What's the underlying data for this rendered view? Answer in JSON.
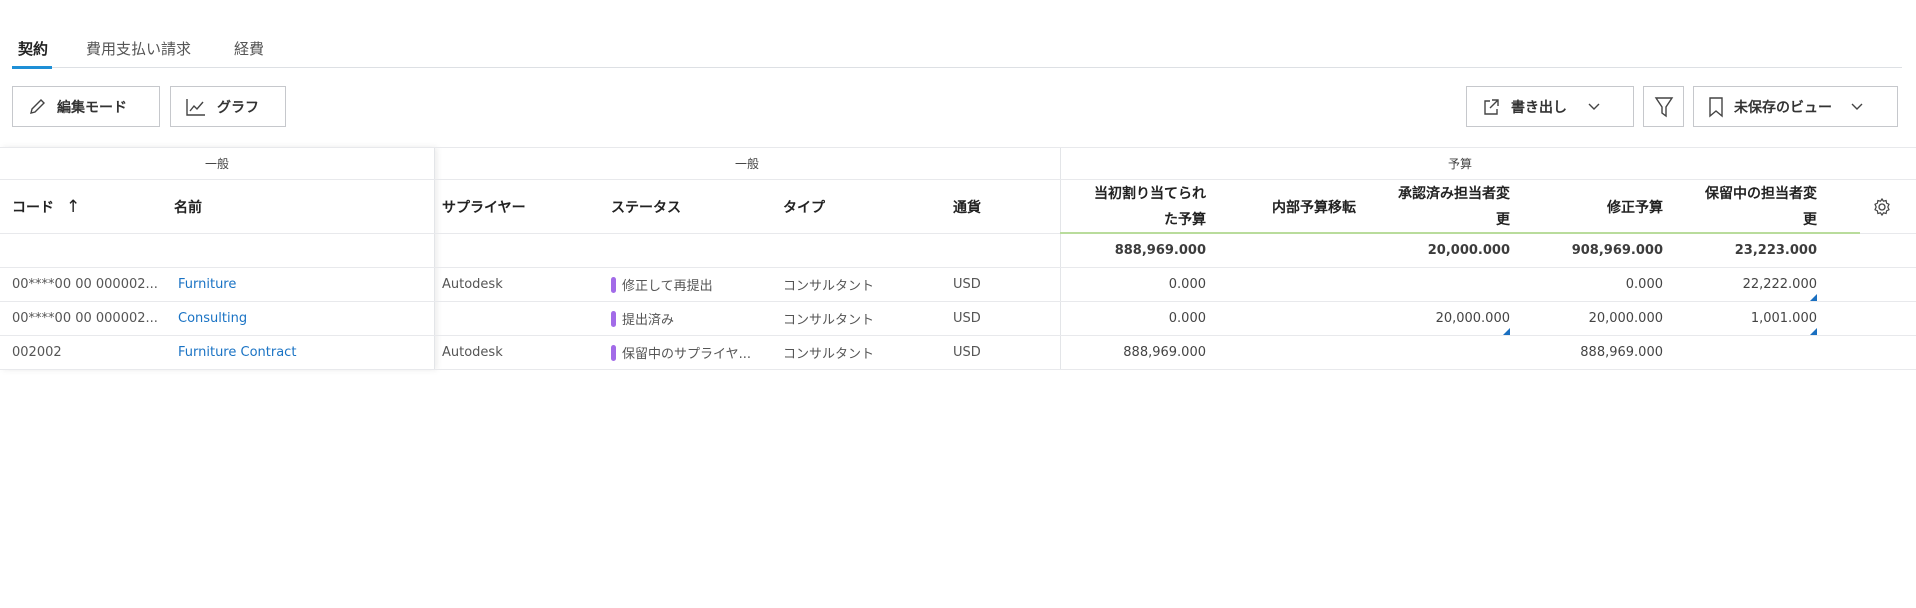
{
  "tabs": [
    {
      "label": "契約",
      "active": true
    },
    {
      "label": "費用支払い請求"
    },
    {
      "label": "経費"
    }
  ],
  "toolbar": {
    "edit_mode": "編集モード",
    "graph": "グラフ",
    "export": "書き出し",
    "view": "未保存のビュー"
  },
  "groups": {
    "left": "一般",
    "middle": "一般",
    "budget": "予算"
  },
  "columns": {
    "code": "コード",
    "name": "名前",
    "supplier": "サプライヤー",
    "status": "ステータス",
    "type": "タイプ",
    "currency": "通貨",
    "original_budget_1": "当初割り当てられ",
    "original_budget_2": "た予算",
    "internal_transfer": "内部予算移転",
    "approved_changes_1": "承認済み担当者変",
    "approved_changes_2": "更",
    "revised_budget": "修正予算",
    "pending_changes_1": "保留中の担当者変",
    "pending_changes_2": "更"
  },
  "sort": {
    "column": "code",
    "direction": "asc"
  },
  "totals": {
    "original_budget": "888,969.000",
    "internal_transfer": "",
    "approved_changes": "20,000.000",
    "revised_budget": "908,969.000",
    "pending_changes": "23,223.000"
  },
  "rows": [
    {
      "code": "00****00 00 000002...",
      "name": "Furniture",
      "supplier": "Autodesk",
      "status": "修正して再提出",
      "type": "コンサルタント",
      "currency": "USD",
      "original_budget": "0.000",
      "internal_transfer": "",
      "approved_changes": "",
      "revised_budget": "0.000",
      "pending_changes": "22,222.000"
    },
    {
      "code": "00****00 00 000002...",
      "name": "Consulting",
      "supplier": "",
      "status": "提出済み",
      "type": "コンサルタント",
      "currency": "USD",
      "original_budget": "0.000",
      "internal_transfer": "",
      "approved_changes": "20,000.000",
      "revised_budget": "20,000.000",
      "pending_changes": "1,001.000"
    },
    {
      "code": "002002",
      "name": "Furniture Contract",
      "supplier": "Autodesk",
      "status": "保留中のサプライヤ...",
      "type": "コンサルタント",
      "currency": "USD",
      "original_budget": "888,969.000",
      "internal_transfer": "",
      "approved_changes": "",
      "revised_budget": "888,969.000",
      "pending_changes": ""
    }
  ],
  "colors": {
    "accent": "#1e8fd6",
    "status": "#a26be8",
    "link": "#1a73c4",
    "budget_line": "#b9dc9c"
  }
}
